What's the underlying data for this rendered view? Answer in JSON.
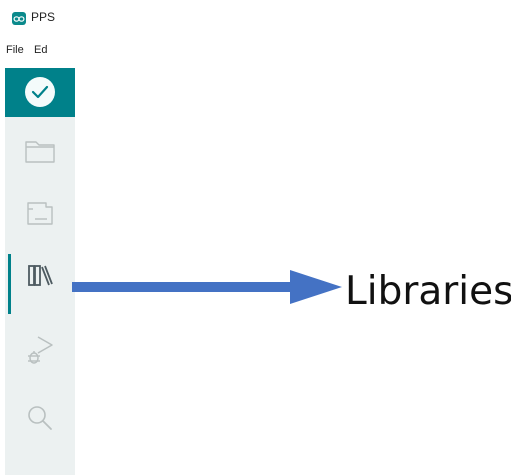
{
  "window": {
    "title": "PPS",
    "icon": "arduino-infinity-icon",
    "logo_color": "#0b8a8c"
  },
  "menubar": {
    "items": [
      {
        "label": "File"
      },
      {
        "label": "Ed"
      }
    ]
  },
  "toolbar": {
    "verify_icon": "check-icon",
    "accent_color": "#00818a"
  },
  "activitybar": {
    "items": [
      {
        "name": "sketchbook",
        "icon": "folder-icon",
        "active": false
      },
      {
        "name": "boards-manager",
        "icon": "board-icon",
        "active": false
      },
      {
        "name": "library-manager",
        "icon": "library-icon",
        "active": true
      },
      {
        "name": "debug",
        "icon": "debug-icon",
        "active": false
      },
      {
        "name": "search",
        "icon": "search-icon",
        "active": false
      }
    ],
    "background": "#ecf1f1"
  },
  "annotation": {
    "label": "Libraries",
    "arrow_color": "#4472c4"
  }
}
